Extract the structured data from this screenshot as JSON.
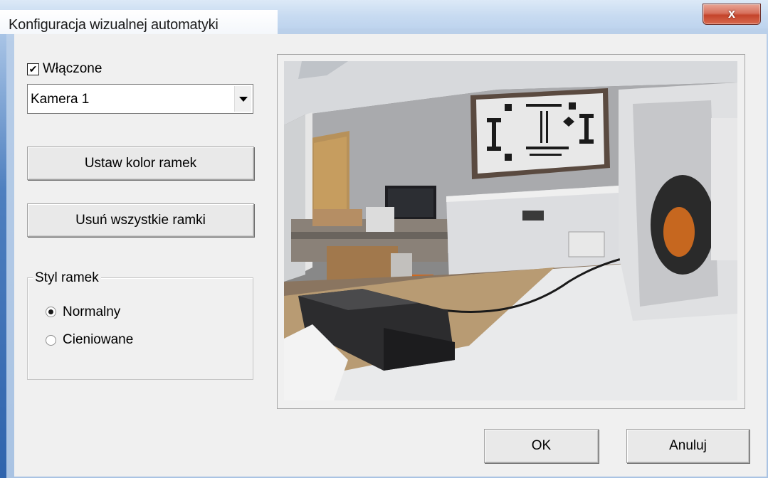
{
  "window": {
    "title": "Konfiguracja wizualnej automatyki",
    "close_glyph": "x"
  },
  "enabled": {
    "label": "Włączone",
    "checked": true
  },
  "camera_select": {
    "value": "Kamera 1"
  },
  "buttons": {
    "set_frame_color": "Ustaw kolor ramek",
    "remove_all_frames": "Usuń wszystkie ramki",
    "ok": "OK",
    "cancel": "Anuluj"
  },
  "frame_style": {
    "title": "Styl ramek",
    "options": [
      {
        "label": "Normalny",
        "selected": true
      },
      {
        "label": "Cieniowane",
        "selected": false
      }
    ]
  },
  "preview": {
    "icon": "camera-preview-image"
  },
  "colors": {
    "close_button": "#c4442b",
    "dialog_bg": "#f0f0f0",
    "frame_blue": "#2f64ad"
  }
}
